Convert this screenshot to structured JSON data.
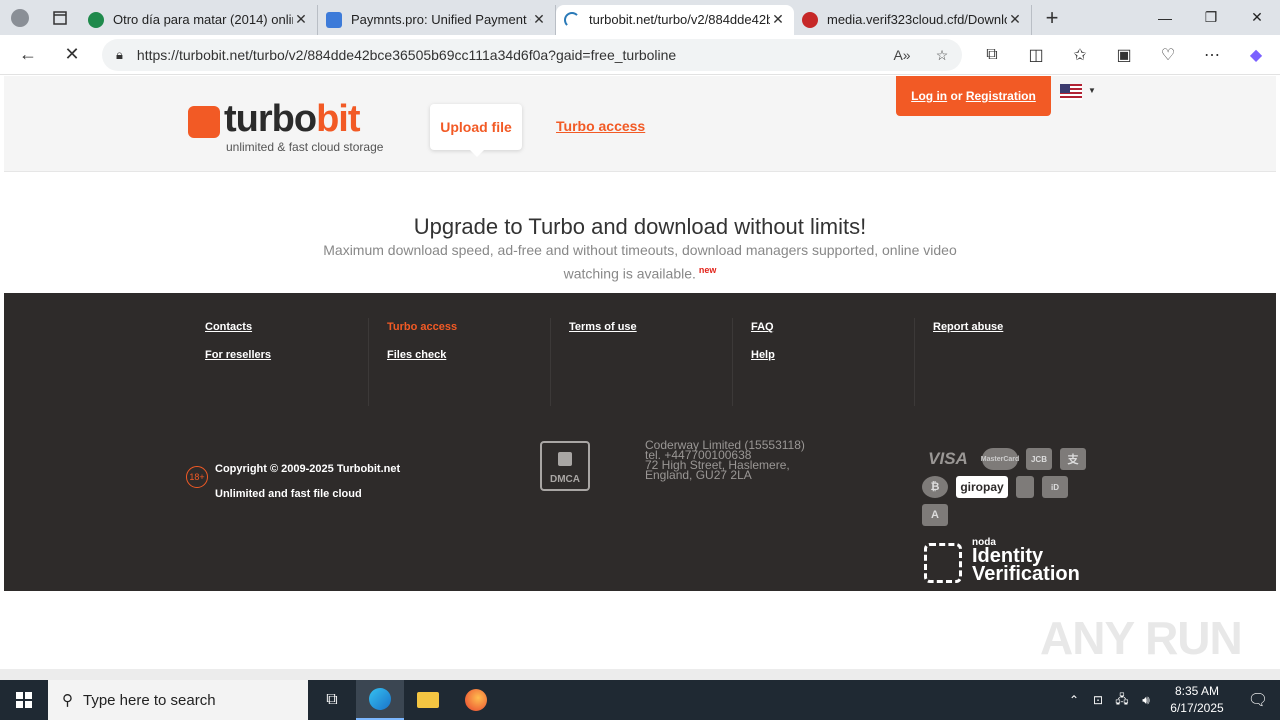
{
  "browser": {
    "tabs": [
      {
        "title": "Otro día para matar (2014) online",
        "favicon_color": "#1f8a4c",
        "active": false
      },
      {
        "title": "Paymnts.pro: Unified Payment Or",
        "favicon_color": "#3d7bd9",
        "active": false
      },
      {
        "title": "turbobit.net/turbo/v2/884dde42b",
        "favicon_color": "#2a7ab8",
        "active": true
      },
      {
        "title": "media.verif323cloud.cfd/Downloa",
        "favicon_color": "#c62828",
        "active": false
      }
    ],
    "url": "https://turbobit.net/turbo/v2/884dde42bce36505b69cc111a34d6f0a?gaid=free_turboline"
  },
  "header": {
    "logo_text_a": "turbo",
    "logo_text_b": "bit",
    "logo_subtitle": "unlimited & fast cloud storage",
    "upload_label": "Upload file",
    "turbo_access_label": "Turbo access",
    "login_label": "Log in",
    "or_label": "or",
    "registration_label": "Registration"
  },
  "promo": {
    "title": "Upgrade to Turbo and download without limits!",
    "subtitle": "Maximum download speed, ad-free and without timeouts, download managers supported, online video watching is available.",
    "badge": "new"
  },
  "footer": {
    "columns": [
      [
        "Contacts",
        "For resellers"
      ],
      [
        "Turbo access",
        "Files check"
      ],
      [
        "Terms of use"
      ],
      [
        "FAQ",
        "Help"
      ],
      [
        "Report abuse"
      ]
    ],
    "age": "18+",
    "copyright": "Copyright © 2009-2025 Turbobit.net",
    "tagline": "Unlimited and fast file cloud",
    "dmca": "DMCA",
    "company": [
      "Coderway Limited (15553118)",
      "tel. +447700100638",
      "72 High Street, Haslemere,",
      "England, GU27 2LA"
    ],
    "payments": [
      "VISA",
      "MasterCard",
      "JCB",
      "Alipay",
      "Bitcoin",
      "giropay",
      "Apple",
      "iDEAL",
      "Astropay"
    ],
    "noda_small": "noda",
    "noda_line1": "Identity",
    "noda_line2": "Verification"
  },
  "watermark": "ANY RUN",
  "taskbar": {
    "search_placeholder": "Type here to search",
    "time": "8:35 AM",
    "date": "6/17/2025"
  },
  "colors": {
    "brand": "#f25a25",
    "footer_bg": "#2e2b2a"
  }
}
